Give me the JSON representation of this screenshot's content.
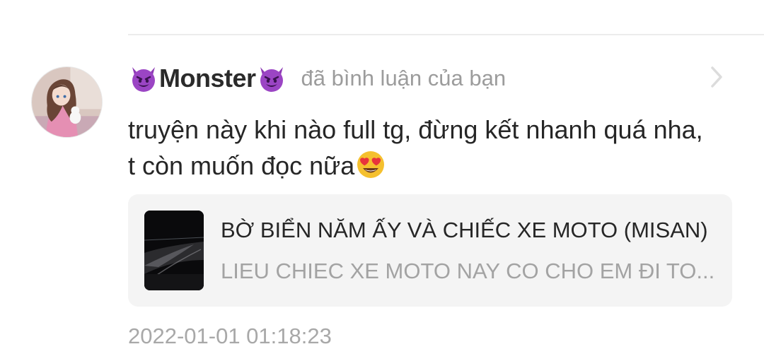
{
  "notification": {
    "username": "Monster",
    "username_emoji": "smiling-imp-emoji",
    "action_text": "đã bình luận của bạn",
    "comment_text": "truyện này khi nào full tg, đừng kết nhanh quá nha, t còn muốn đọc nữa",
    "comment_emoji": "heart-eyes-emoji",
    "timestamp": "2022-01-01 01:18:23"
  },
  "story_card": {
    "title": "BỜ BIỂN NĂM ẤY VÀ CHIẾC XE MOTO (MISAN)",
    "subtitle": "LIEU CHIEC XE MOTO NAY CO CHO EM ĐI TO..."
  },
  "icons": {
    "chevron": "chevron-right-icon",
    "avatar": "user-avatar"
  },
  "colors": {
    "username": "#2b2b2b",
    "muted": "#9c9c9c",
    "card_bg": "#f4f4f4",
    "divider": "#ececec"
  }
}
